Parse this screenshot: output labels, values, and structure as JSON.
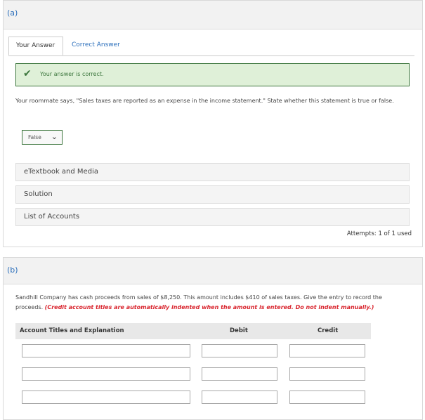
{
  "part_a": {
    "label": "(a)",
    "tabs": [
      "Your Answer",
      "Correct Answer"
    ],
    "feedback": "Your answer is correct.",
    "question": "Your roommate says, \"Sales taxes are reported as an expense in the income statement.\" State whether this statement is true or false.",
    "answer_value": "False",
    "resources": [
      "eTextbook and Media",
      "Solution",
      "List of Accounts"
    ],
    "attempts": "Attempts: 1 of 1 used"
  },
  "part_b": {
    "label": "(b)",
    "question": "Sandhill Company has cash proceeds from sales of $8,250. This amount includes $410 of sales taxes. Give the entry to record the proceeds.",
    "instruction": "(Credit account titles are automatically indented when the amount is entered. Do not indent manually.)",
    "columns": [
      "Account Titles and Explanation",
      "Debit",
      "Credit"
    ]
  },
  "icons": {
    "feedback": "check-icon",
    "select": "chevron-down-icon"
  },
  "colors": {
    "link": "#2a6ebb",
    "success": "#3c763d",
    "success_bg": "#dff0d8",
    "instruction": "#d9262f"
  }
}
